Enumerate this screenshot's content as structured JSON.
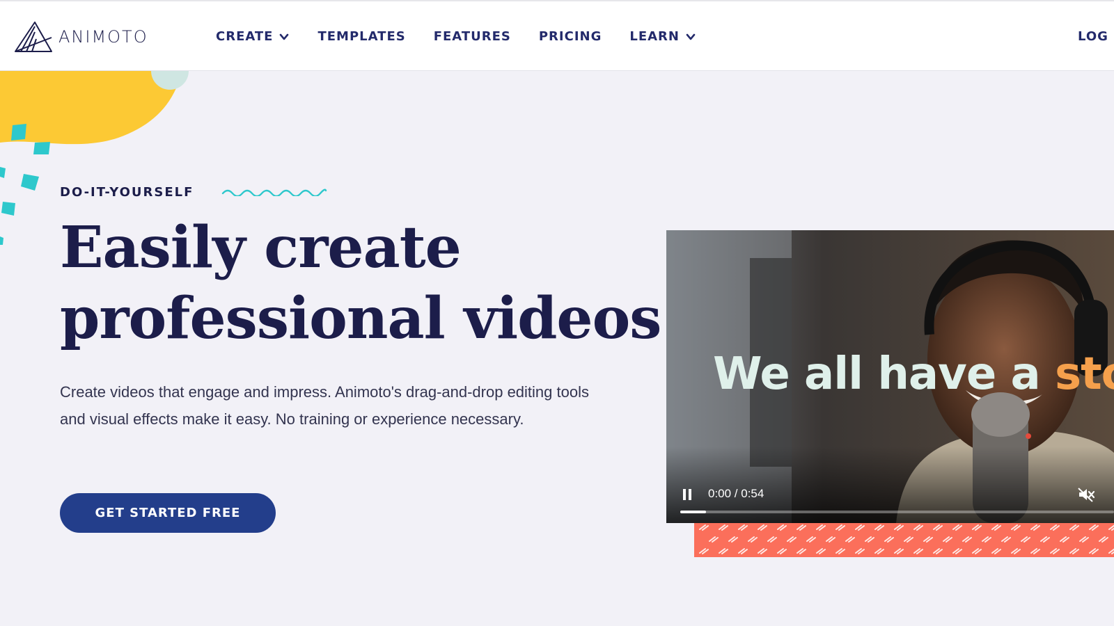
{
  "header": {
    "logo_text": "ANIMOTO",
    "nav": [
      {
        "label": "CREATE",
        "has_dropdown": true
      },
      {
        "label": "TEMPLATES",
        "has_dropdown": false
      },
      {
        "label": "FEATURES",
        "has_dropdown": false
      },
      {
        "label": "PRICING",
        "has_dropdown": false
      },
      {
        "label": "LEARN",
        "has_dropdown": true
      }
    ],
    "login_label": "LOG"
  },
  "hero": {
    "eyebrow": "DO-IT-YOURSELF",
    "headline_line1": "Easily create",
    "headline_line2": "professional videos",
    "subtext": "Create videos that engage and impress. Animoto's drag-and-drop editing tools and visual effects make it easy. No training or experience necessary.",
    "cta_label": "GET STARTED FREE"
  },
  "video": {
    "overlay_text_main": "We all have a ",
    "overlay_text_accent": "stor",
    "time_display": "0:00 / 0:54",
    "progress_fraction": 0.06,
    "state": "playing",
    "muted": true
  },
  "colors": {
    "brand_navy": "#1c1d4a",
    "cta_blue": "#233e8b",
    "accent_yellow": "#fcc934",
    "accent_teal": "#2ec8cc",
    "accent_coral": "#fb6f5b",
    "accent_orange": "#f5a04c",
    "page_bg": "#f2f1f7"
  },
  "icons": [
    "animoto-logo-icon",
    "chevron-down-icon",
    "wave-icon",
    "pause-icon",
    "mute-icon"
  ]
}
